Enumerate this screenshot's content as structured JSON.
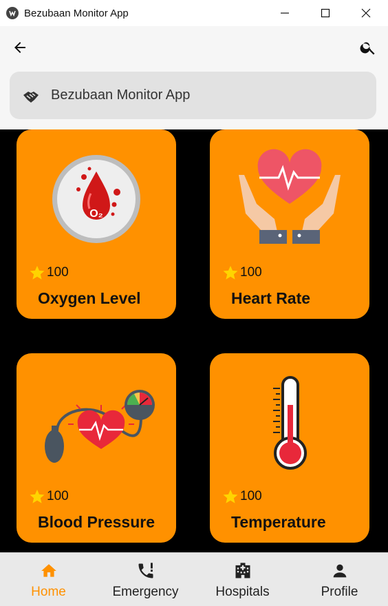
{
  "window": {
    "title": "Bezubaan Monitor App"
  },
  "appbar": {
    "search_text": "Bezubaan Monitor App"
  },
  "cards": [
    {
      "rating": "100",
      "title": "Oxygen Level"
    },
    {
      "rating": "100",
      "title": "Heart Rate"
    },
    {
      "rating": "100",
      "title": "Blood Pressure"
    },
    {
      "rating": "100",
      "title": "Temperature"
    }
  ],
  "nav": [
    {
      "label": "Home",
      "icon": "home-icon",
      "active": true
    },
    {
      "label": "Emergency",
      "icon": "phone-alert-icon",
      "active": false
    },
    {
      "label": "Hospitals",
      "icon": "hospital-icon",
      "active": false
    },
    {
      "label": "Profile",
      "icon": "person-icon",
      "active": false
    }
  ],
  "colors": {
    "accent": "#ff9100",
    "background": "#000000",
    "appbar": "#f6f6f6"
  }
}
